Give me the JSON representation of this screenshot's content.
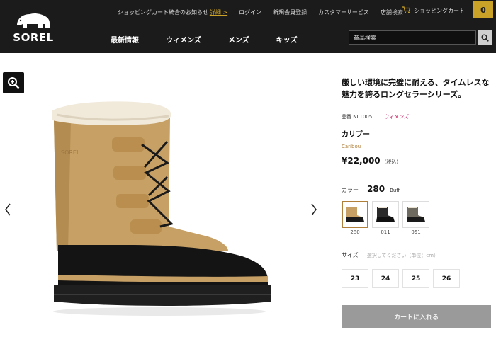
{
  "brand": {
    "name": "SOREL",
    "logo_icon": "polar-bear-icon"
  },
  "utility_nav": {
    "notice_text": "ショッピングカート統合のお知らせ",
    "notice_link": "詳細 >",
    "items": [
      "ログイン",
      "新規会員登録",
      "カスタマーサービス",
      "店舗検索"
    ]
  },
  "cart": {
    "label": "ショッピングカート",
    "count": "0"
  },
  "main_nav": {
    "items": [
      "最新情報",
      "ウィメンズ",
      "メンズ",
      "キッズ"
    ]
  },
  "search": {
    "placeholder": "商品検索"
  },
  "product": {
    "tagline": "厳しい環境に完璧に耐える、タイムレスな魅力を誇るロングセラーシリーズ。",
    "code": "品番 NL1005",
    "gender": "ウィメンズ",
    "name": "カリブー",
    "name_en": "Caribou",
    "price": "¥22,000",
    "tax_note": "(税込)",
    "color_label": "カラー",
    "color_code": "280",
    "color_name": "Buff",
    "swatches": [
      {
        "label": "280",
        "shaft": "#c7a065",
        "base": "#1a1a1a"
      },
      {
        "label": "011",
        "shaft": "#2a2a2a",
        "base": "#111111"
      },
      {
        "label": "051",
        "shaft": "#6f6a60",
        "base": "#1a1a1a"
      }
    ],
    "size_label": "サイズ",
    "size_hint": "選択してください（単位：cm）",
    "sizes": [
      "23",
      "24",
      "25",
      "26"
    ],
    "add_to_cart": "カートに入れる"
  },
  "colors": {
    "header_bg": "#1b1b1b",
    "accent_gold": "#c9a227",
    "pink": "#c2185b",
    "button_gray": "#9a9a9a"
  }
}
